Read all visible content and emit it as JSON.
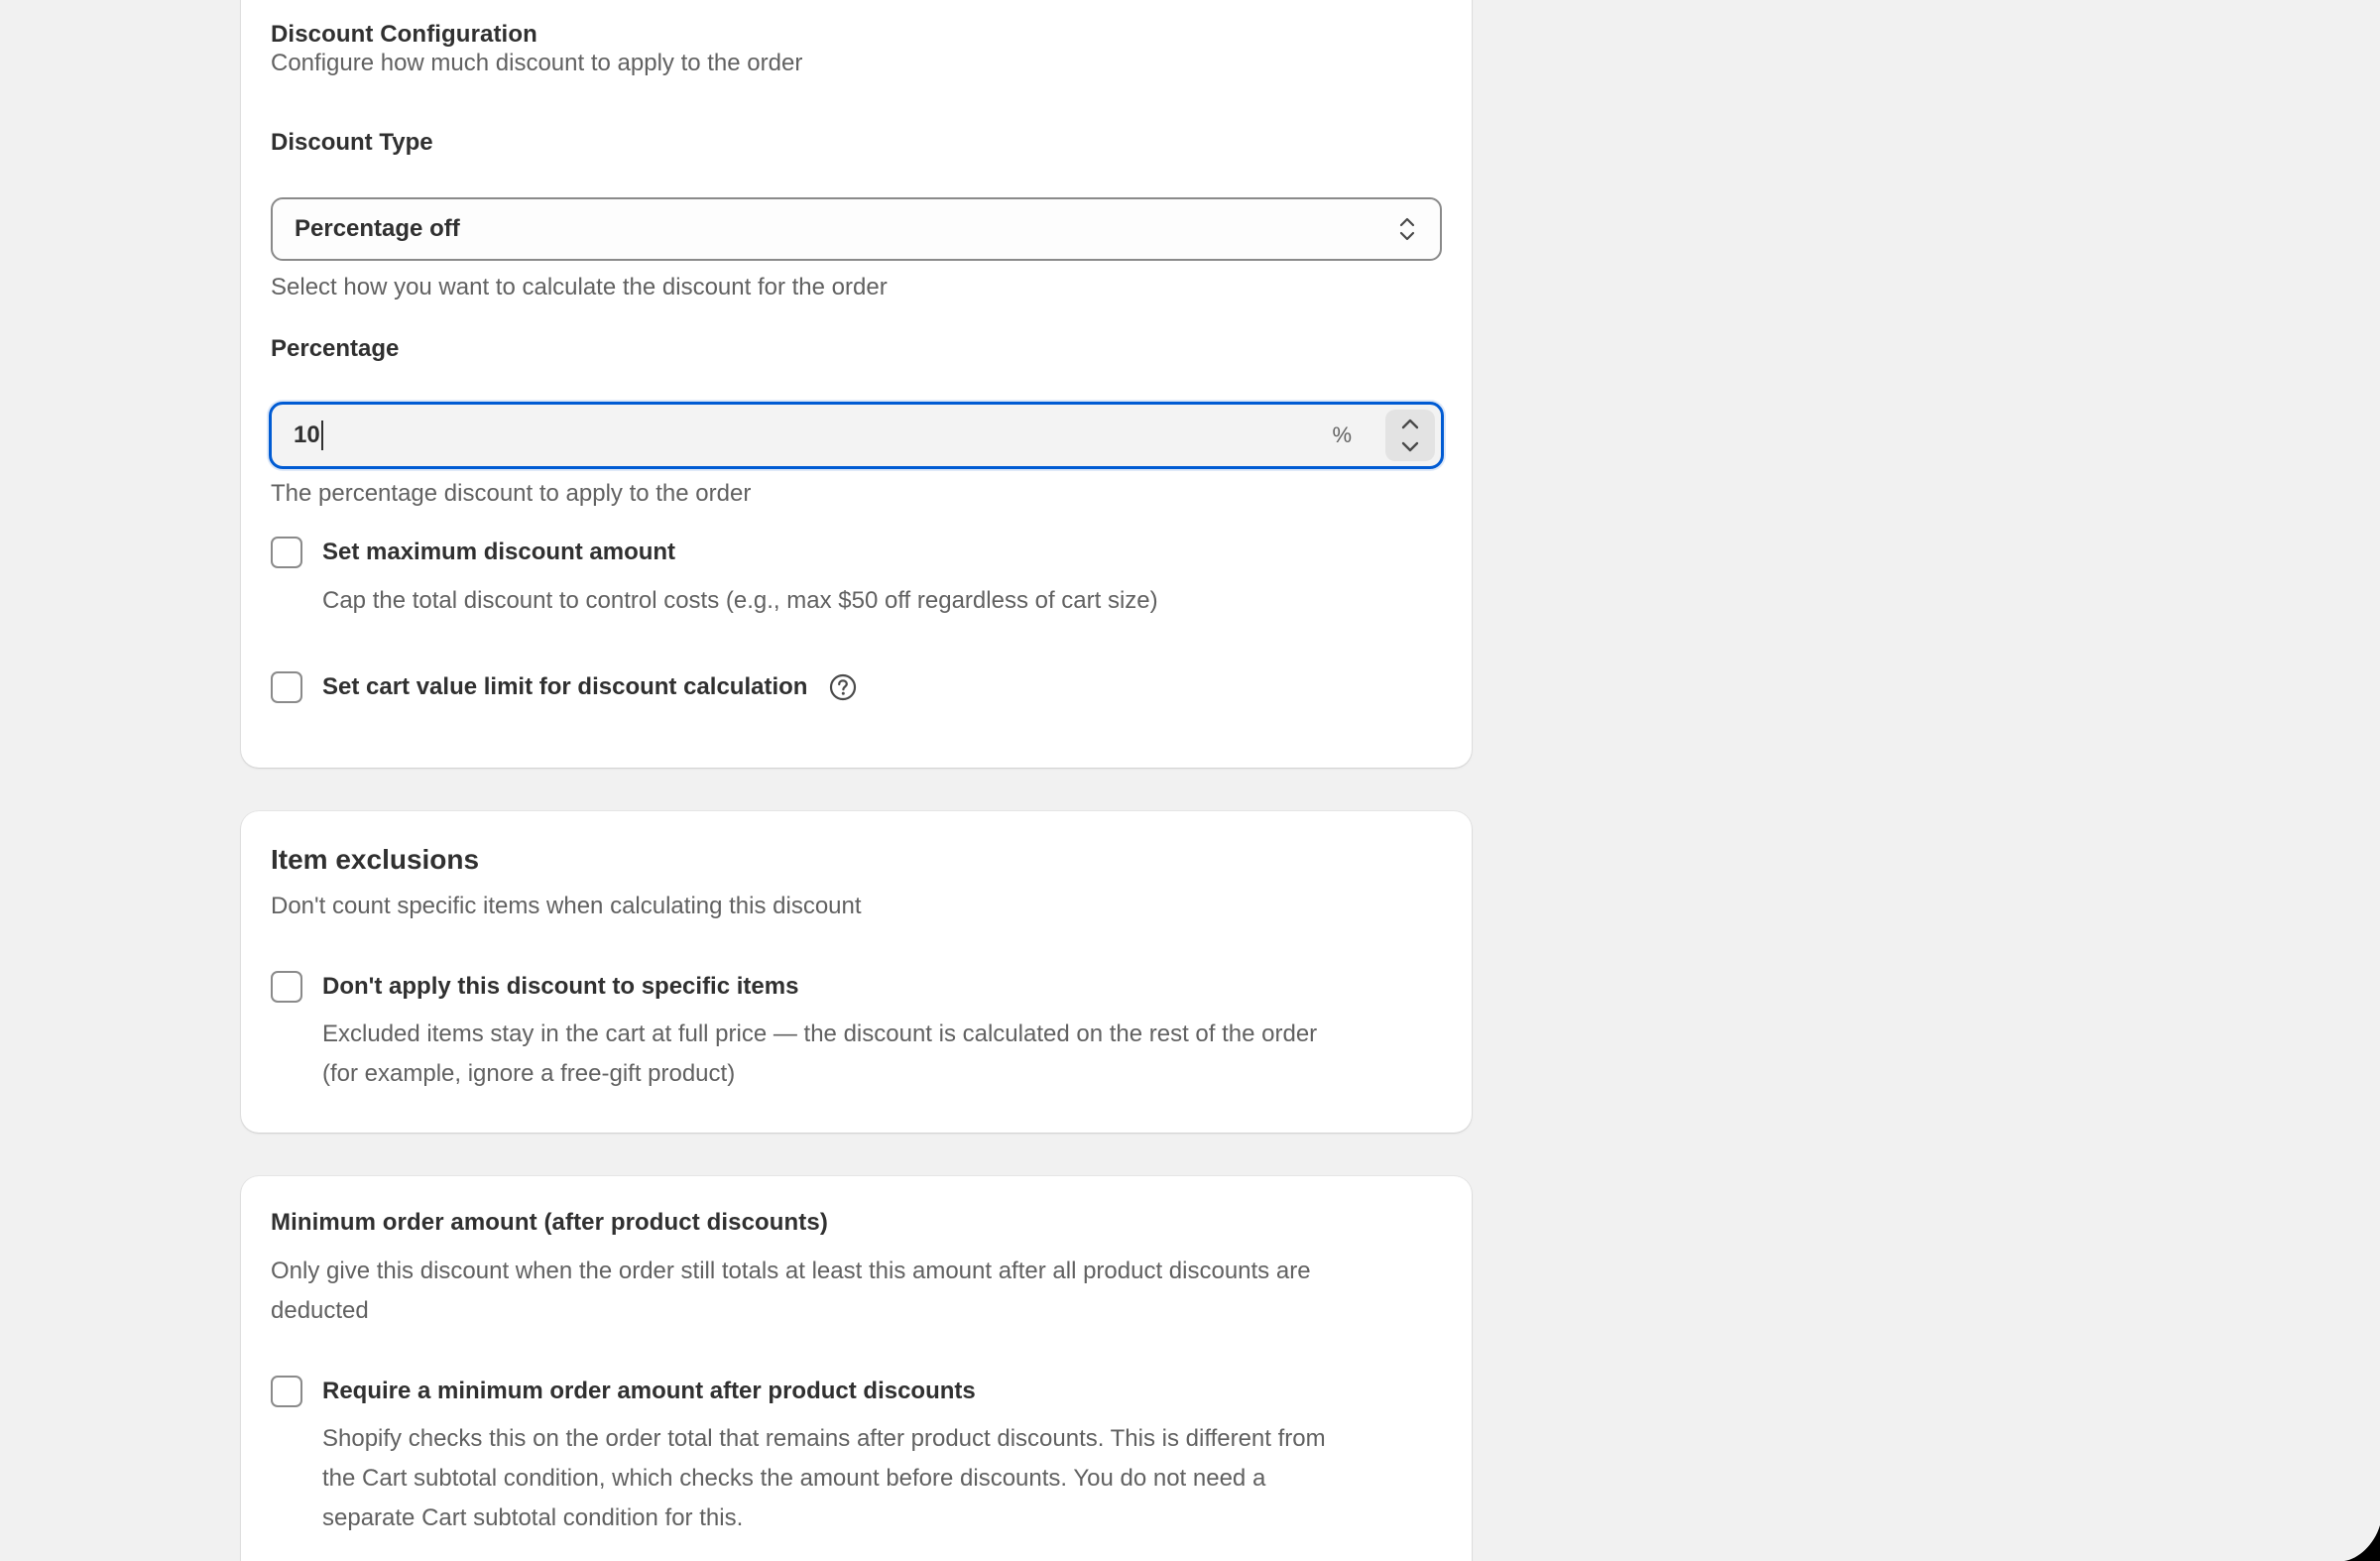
{
  "discount_config": {
    "title": "Discount Configuration",
    "subtitle": "Configure how much discount to apply to the order",
    "type_label": "Discount Type",
    "type_value": "Percentage off",
    "type_help": "Select how you want to calculate the discount for the order",
    "percentage_label": "Percentage",
    "percentage_value": "10",
    "percentage_suffix": "%",
    "percentage_help": "The percentage discount to apply to the order",
    "max_discount_label": "Set maximum discount amount",
    "max_discount_desc": "Cap the total discount to control costs (e.g., max $50 off regardless of cart size)",
    "cart_limit_label": "Set cart value limit for discount calculation"
  },
  "item_exclusions": {
    "title": "Item exclusions",
    "subtitle": "Don't count specific items when calculating this discount",
    "checkbox_label": "Don't apply this discount to specific items",
    "desc_line1": "Excluded items stay in the cart at full price — the discount is calculated on the rest of the order",
    "desc_line2": "(for example, ignore a free-gift product)"
  },
  "minimum_order": {
    "title": "Minimum order amount (after product discounts)",
    "subtitle_line1": "Only give this discount when the order still totals at least this amount after all product discounts are",
    "subtitle_line2": "deducted",
    "checkbox_label": "Require a minimum order amount after product discounts",
    "desc_line1": "Shopify checks this on the order total that remains after product discounts. This is different from",
    "desc_line2": "the Cart subtotal condition, which checks the amount before discounts. You do not need a",
    "desc_line3": "separate Cart subtotal condition for this."
  },
  "colors": {
    "focus_ring": "#005bd3",
    "muted_text": "#616161",
    "primary_text": "#303030",
    "background": "#f1f1f1"
  }
}
